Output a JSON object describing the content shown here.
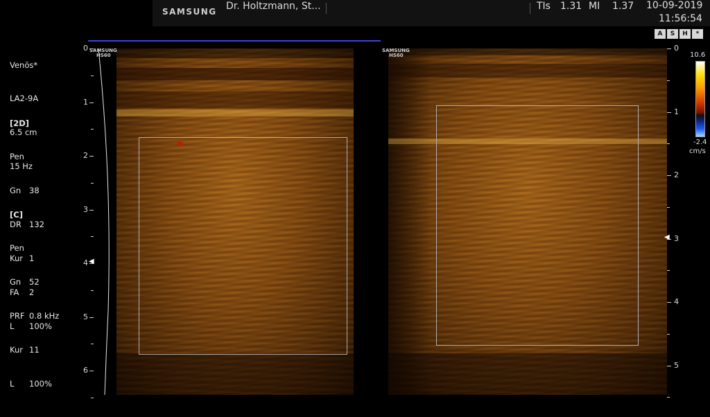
{
  "header": {
    "brand": "SAMSUNG",
    "doctor": "Dr. Holtzmann, St...",
    "tis_label": "TIs",
    "tis_value": "1.31",
    "mi_label": "MI",
    "mi_value": "1.37",
    "date": "10-09-2019",
    "time": "11:56:54"
  },
  "preset": {
    "name": "Venös*",
    "probe": "LA2-9A",
    "depth": "6.5 cm",
    "frame_rate": "15 Hz"
  },
  "mode_2d": {
    "title": "[2D]",
    "mode": "Pen",
    "params": [
      {
        "k": "Gn",
        "v": "38"
      },
      {
        "k": "DR",
        "v": "132"
      },
      {
        "k": "Kur",
        "v": "1"
      },
      {
        "k": "FA",
        "v": "2"
      },
      {
        "k": "L",
        "v": "100%"
      }
    ]
  },
  "mode_color": {
    "title": "[C]",
    "mode": "Pen",
    "params": [
      {
        "k": "Gn",
        "v": "52"
      },
      {
        "k": "PRF",
        "v": "0.8 kHz"
      },
      {
        "k": "Kur",
        "v": "11"
      },
      {
        "k": "L",
        "v": "100%"
      }
    ]
  },
  "color_scale": {
    "max": "10.6",
    "min": "-2.4",
    "unit": "cm/s"
  },
  "mode_icons": [
    "A",
    "S",
    "H",
    "*"
  ],
  "probe_tag": {
    "line1": "SAMSUNG",
    "line2": "HS60"
  },
  "left_ruler": {
    "labels": [
      "0",
      "1",
      "2",
      "3",
      "4",
      "5",
      "6"
    ]
  },
  "right_ruler": {
    "labels": [
      "0",
      "1",
      "2",
      "3",
      "4",
      "5"
    ]
  },
  "colors": {
    "tissue": "#b16a1a",
    "roi_box": "#b0b0b0",
    "accent_line": "#3a45d8"
  }
}
